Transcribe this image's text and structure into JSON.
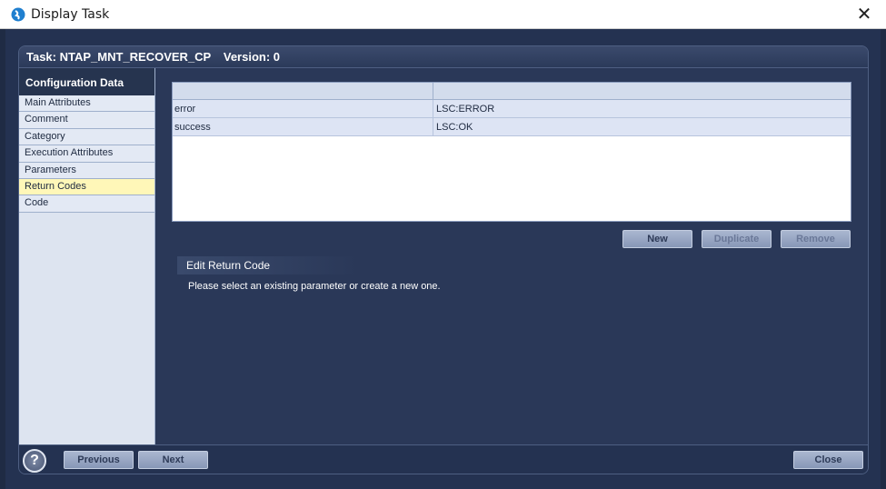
{
  "window": {
    "title": "Display Task",
    "close_glyph": "✕"
  },
  "panel": {
    "task_label": "Task: NTAP_MNT_RECOVER_CP",
    "version_label": "Version: 0"
  },
  "sidebar": {
    "heading": "Configuration Data",
    "items": [
      {
        "label": "Main Attributes"
      },
      {
        "label": "Comment"
      },
      {
        "label": "Category"
      },
      {
        "label": "Execution Attributes"
      },
      {
        "label": "Parameters"
      },
      {
        "label": "Return Codes",
        "selected": true
      },
      {
        "label": "Code"
      }
    ]
  },
  "table": {
    "columns": [
      "",
      ""
    ],
    "rows": [
      [
        "error",
        "LSC:ERROR"
      ],
      [
        "success",
        "LSC:OK"
      ]
    ]
  },
  "actions": {
    "new_label": "New",
    "duplicate_label": "Duplicate",
    "remove_label": "Remove"
  },
  "edit": {
    "header": "Edit Return Code",
    "hint": "Please select an existing parameter or create a new one."
  },
  "footer": {
    "help_glyph": "?",
    "previous_label": "Previous",
    "next_label": "Next",
    "close_label": "Close"
  },
  "colors": {
    "background": "#2b3a5c",
    "selected_item": "#fff7b8",
    "button": "#8797b7"
  }
}
